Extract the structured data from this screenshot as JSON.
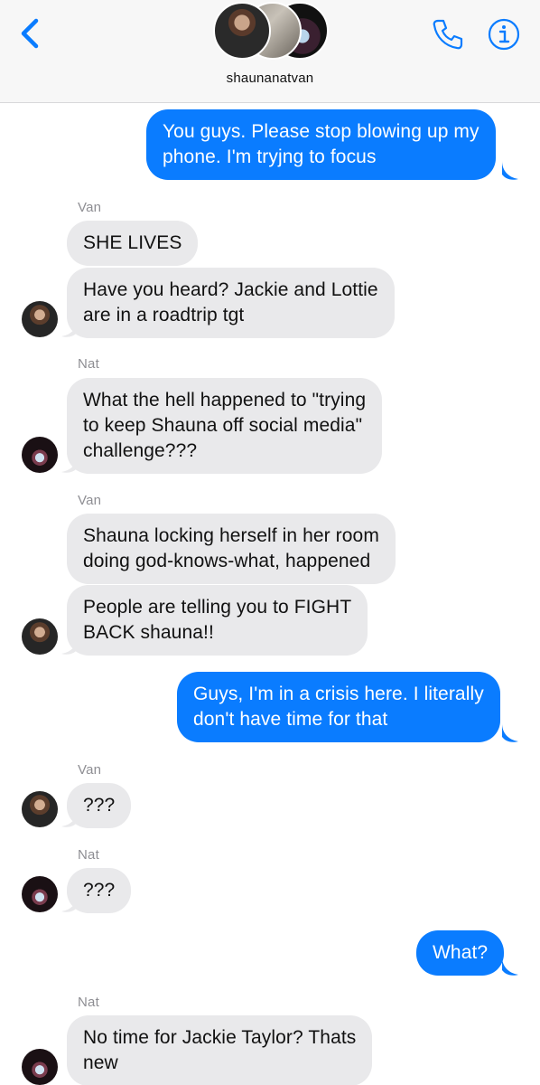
{
  "header": {
    "group_name": "shaunanatvan",
    "back_icon": "chevron-left-icon",
    "call_icon": "phone-icon",
    "info_icon": "info-icon",
    "accent_color": "#0a7cff"
  },
  "colors": {
    "outgoing_bubble": "#0a7cff",
    "incoming_bubble": "#e9e9eb",
    "sender_label": "#8e8e93"
  },
  "messages": [
    {
      "direction": "outgoing",
      "lines": [
        "You guys. Please stop blowing up my",
        "phone. I'm tryjng to focus"
      ]
    },
    {
      "direction": "incoming",
      "sender": "Van",
      "lines": [
        "SHE LIVES"
      ]
    },
    {
      "direction": "incoming",
      "lines": [
        "Have you heard? Jackie and Lottie",
        "are in a roadtrip tgt"
      ]
    },
    {
      "direction": "incoming",
      "sender": "Nat",
      "lines": [
        "What the hell happened to \"trying",
        "to keep Shauna off social media\"",
        "challenge???"
      ]
    },
    {
      "direction": "incoming",
      "sender": "Van",
      "lines": [
        "Shauna locking herself in her room",
        "doing god-knows-what, happened"
      ]
    },
    {
      "direction": "incoming",
      "lines": [
        "People are telling you to FIGHT",
        "BACK shauna!!"
      ]
    },
    {
      "direction": "outgoing",
      "lines": [
        "Guys, I'm in a crisis here. I literally",
        "don't have time for that"
      ]
    },
    {
      "direction": "incoming",
      "sender": "Van",
      "lines": [
        "???"
      ]
    },
    {
      "direction": "incoming",
      "sender": "Nat",
      "lines": [
        "???"
      ]
    },
    {
      "direction": "outgoing",
      "lines": [
        "What?"
      ]
    },
    {
      "direction": "incoming",
      "sender": "Nat",
      "lines": [
        "No time for Jackie Taylor? Thats",
        "new"
      ]
    }
  ]
}
